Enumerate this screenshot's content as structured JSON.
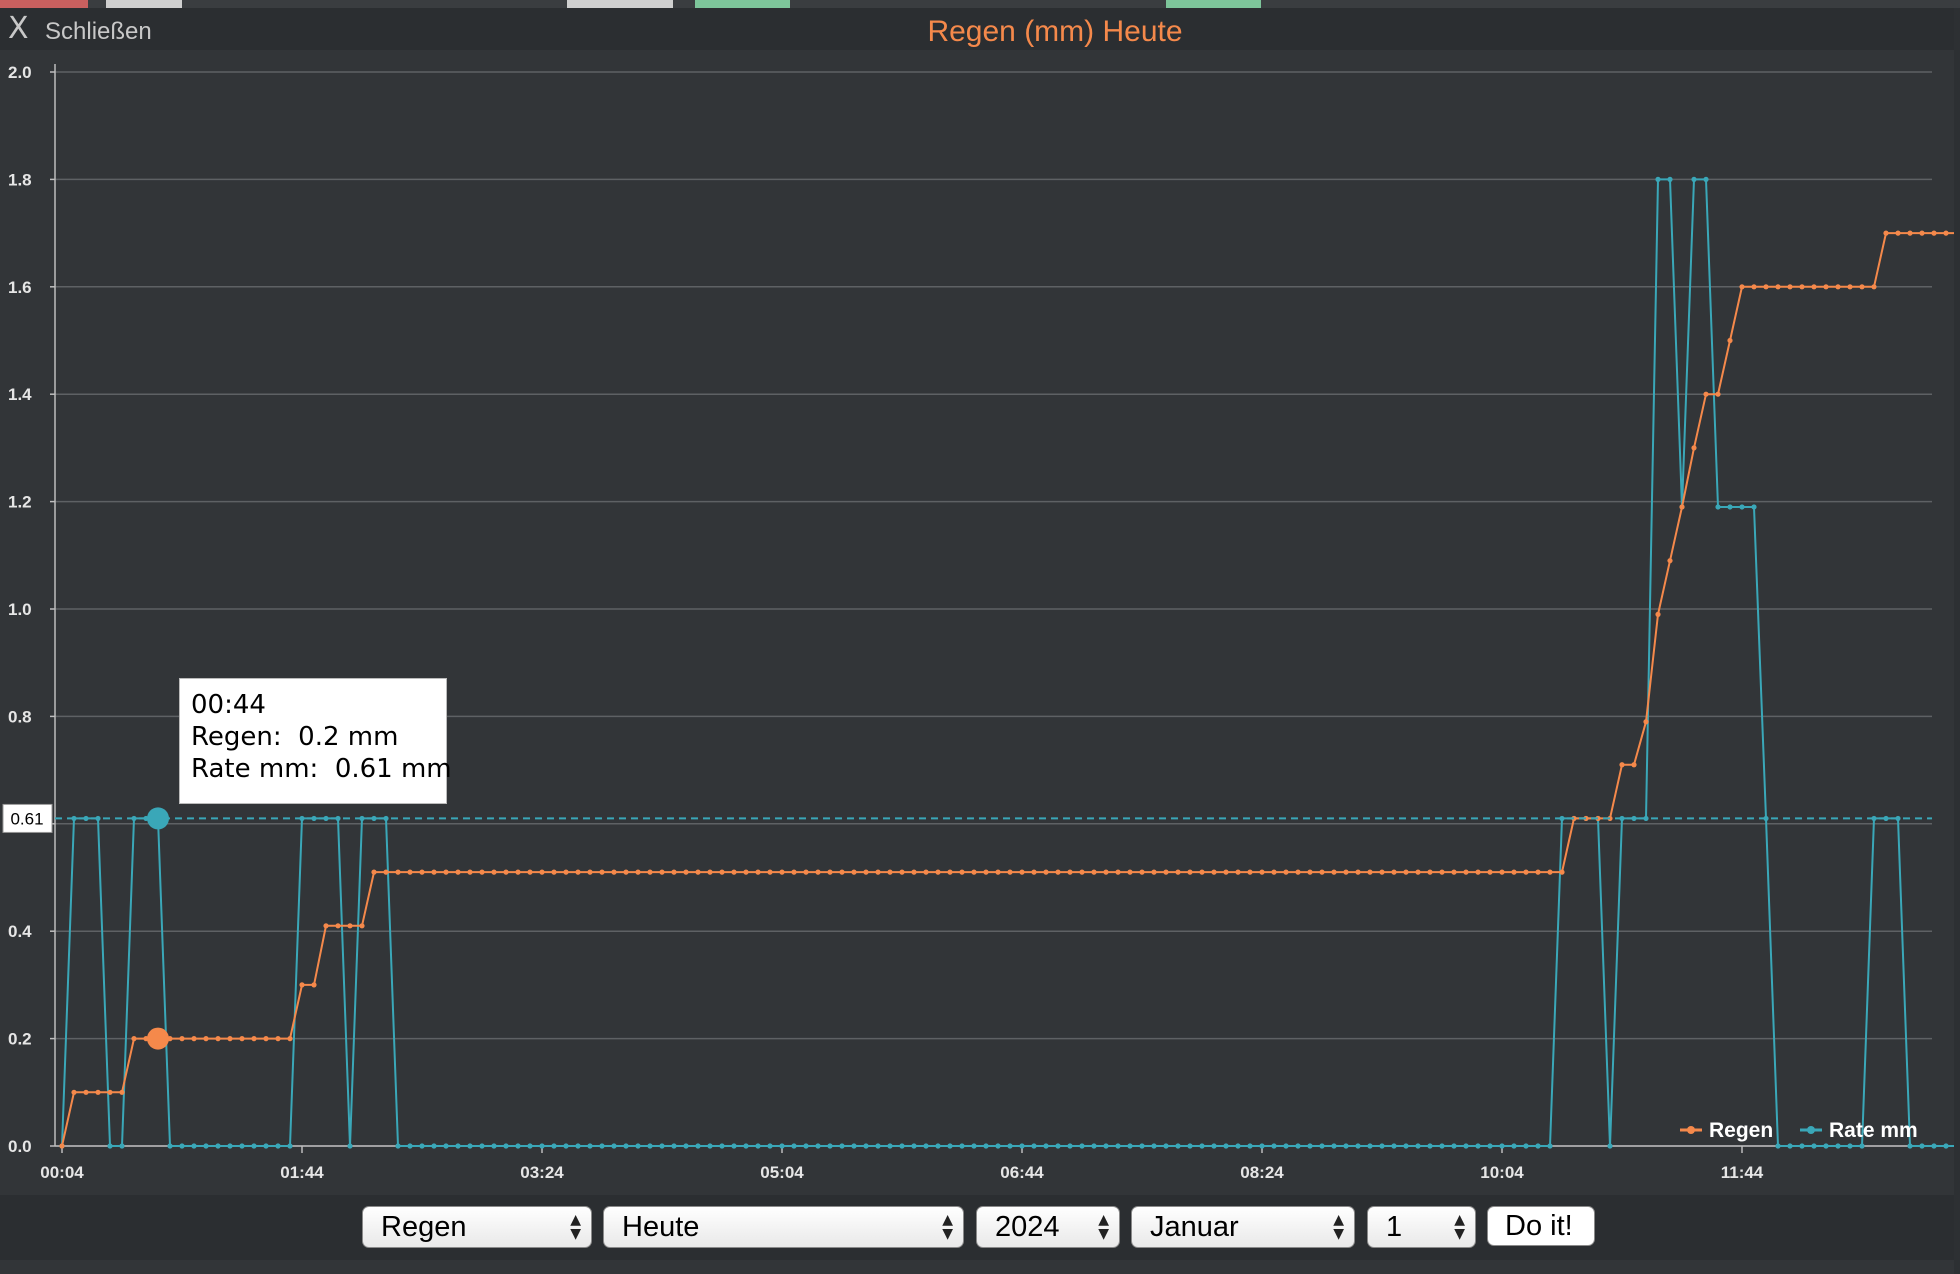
{
  "window": {
    "close_symbol": "X",
    "close_label": "Schließen",
    "title": "Regen (mm) Heute"
  },
  "tooltip": {
    "time": "00:44",
    "line1": "Regen:  0.2 mm",
    "line2": "Rate mm:  0.61 mm"
  },
  "controls": {
    "field": "Regen",
    "period": "Heute",
    "year": "2024",
    "month": "Januar",
    "day": "1",
    "submit": "Do it!"
  },
  "colors": {
    "regen": "#f5894b",
    "rate": "#3aa7b8",
    "background": "#323538",
    "grid": "#5e6164"
  },
  "chart_data": {
    "type": "line",
    "title": "Regen (mm) Heute",
    "x_start": "00:04",
    "x_step_minutes": 5,
    "x_ticks": [
      "00:04",
      "01:44",
      "03:24",
      "05:04",
      "06:44",
      "08:24",
      "10:04",
      "11:44"
    ],
    "ylim": [
      0,
      2.0
    ],
    "y_ticks": [
      "0.0",
      "0.2",
      "0.4",
      "0.6",
      "0.8",
      "1.0",
      "1.2",
      "1.4",
      "1.6",
      "1.8",
      "2.0"
    ],
    "grid": true,
    "legend": "bottom-right",
    "crosshair_y": 0.61,
    "crosshair_label": "0.61",
    "highlight_time": "00:44",
    "series": [
      {
        "name": "Regen",
        "color": "#f5894b",
        "values": [
          0,
          0.1,
          0.1,
          0.1,
          0.1,
          0.1,
          0.2,
          0.2,
          0.2,
          0.2,
          0.2,
          0.2,
          0.2,
          0.2,
          0.2,
          0.2,
          0.2,
          0.2,
          0.2,
          0.2,
          0.3,
          0.3,
          0.41,
          0.41,
          0.41,
          0.41,
          0.51,
          0.51,
          0.51,
          0.51,
          0.51,
          0.51,
          0.51,
          0.51,
          0.51,
          0.51,
          0.51,
          0.51,
          0.51,
          0.51,
          0.51,
          0.51,
          0.51,
          0.51,
          0.51,
          0.51,
          0.51,
          0.51,
          0.51,
          0.51,
          0.51,
          0.51,
          0.51,
          0.51,
          0.51,
          0.51,
          0.51,
          0.51,
          0.51,
          0.51,
          0.51,
          0.51,
          0.51,
          0.51,
          0.51,
          0.51,
          0.51,
          0.51,
          0.51,
          0.51,
          0.51,
          0.51,
          0.51,
          0.51,
          0.51,
          0.51,
          0.51,
          0.51,
          0.51,
          0.51,
          0.51,
          0.51,
          0.51,
          0.51,
          0.51,
          0.51,
          0.51,
          0.51,
          0.51,
          0.51,
          0.51,
          0.51,
          0.51,
          0.51,
          0.51,
          0.51,
          0.51,
          0.51,
          0.51,
          0.51,
          0.51,
          0.51,
          0.51,
          0.51,
          0.51,
          0.51,
          0.51,
          0.51,
          0.51,
          0.51,
          0.51,
          0.51,
          0.51,
          0.51,
          0.51,
          0.51,
          0.51,
          0.51,
          0.51,
          0.51,
          0.51,
          0.51,
          0.51,
          0.51,
          0.51,
          0.51,
          0.61,
          0.61,
          0.61,
          0.61,
          0.71,
          0.71,
          0.79,
          0.99,
          1.09,
          1.19,
          1.3,
          1.4,
          1.4,
          1.5,
          1.6,
          1.6,
          1.6,
          1.6,
          1.6,
          1.6,
          1.6,
          1.6,
          1.6,
          1.6,
          1.6,
          1.6,
          1.7,
          1.7,
          1.7,
          1.7,
          1.7,
          1.7,
          1.7,
          1.7,
          1.7,
          1.7
        ]
      },
      {
        "name": "Rate mm",
        "color": "#3aa7b8",
        "values": [
          0,
          0.61,
          0.61,
          0.61,
          0,
          0,
          0.61,
          0.61,
          0.61,
          0,
          0,
          0,
          0,
          0,
          0,
          0,
          0,
          0,
          0,
          0,
          0.61,
          0.61,
          0.61,
          0.61,
          0,
          0.61,
          0.61,
          0.61,
          0,
          0,
          0,
          0,
          0,
          0,
          0,
          0,
          0,
          0,
          0,
          0,
          0,
          0,
          0,
          0,
          0,
          0,
          0,
          0,
          0,
          0,
          0,
          0,
          0,
          0,
          0,
          0,
          0,
          0,
          0,
          0,
          0,
          0,
          0,
          0,
          0,
          0,
          0,
          0,
          0,
          0,
          0,
          0,
          0,
          0,
          0,
          0,
          0,
          0,
          0,
          0,
          0,
          0,
          0,
          0,
          0,
          0,
          0,
          0,
          0,
          0,
          0,
          0,
          0,
          0,
          0,
          0,
          0,
          0,
          0,
          0,
          0,
          0,
          0,
          0,
          0,
          0,
          0,
          0,
          0,
          0,
          0,
          0,
          0,
          0,
          0,
          0,
          0,
          0,
          0,
          0,
          0,
          0,
          0,
          0,
          0,
          0.61,
          0.61,
          0.61,
          0.61,
          0,
          0.61,
          0.61,
          0.61,
          1.8,
          1.8,
          1.19,
          1.8,
          1.8,
          1.19,
          1.19,
          1.19,
          1.19,
          0.61,
          0,
          0,
          0,
          0,
          0,
          0,
          0,
          0,
          0.61,
          0.61,
          0.61,
          0,
          0,
          0,
          0,
          0,
          0
        ]
      }
    ]
  }
}
